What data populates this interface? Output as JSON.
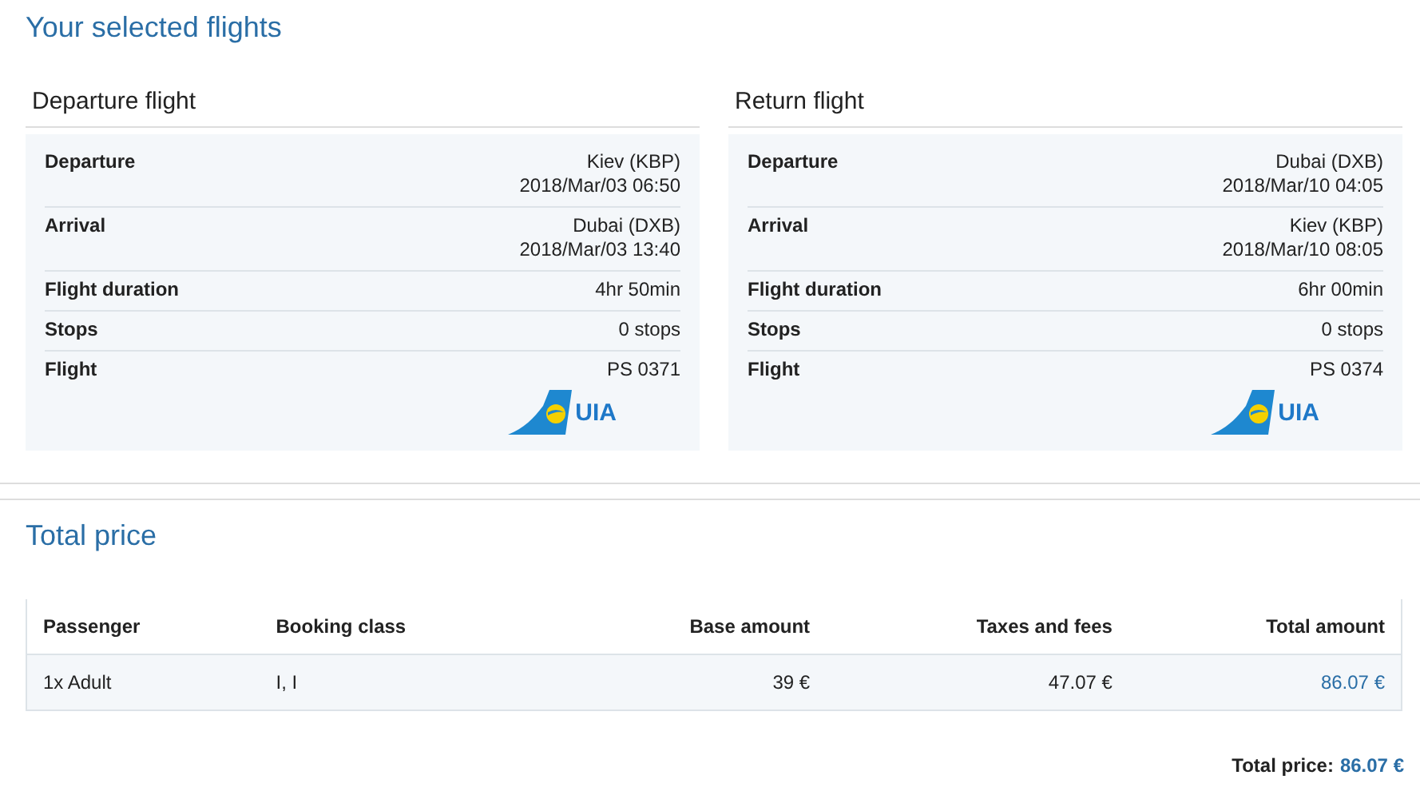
{
  "title": "Your selected flights",
  "flights": [
    {
      "heading": "Departure flight",
      "rows": [
        {
          "label": "Departure",
          "lines": [
            "Kiev (KBP)",
            "2018/Mar/03 06:50"
          ]
        },
        {
          "label": "Arrival",
          "lines": [
            "Dubai (DXB)",
            "2018/Mar/03 13:40"
          ]
        },
        {
          "label": "Flight duration",
          "lines": [
            "4hr 50min"
          ]
        },
        {
          "label": "Stops",
          "lines": [
            "0 stops"
          ]
        },
        {
          "label": "Flight",
          "lines": [
            "PS 0371"
          ]
        }
      ],
      "airline": "UIA"
    },
    {
      "heading": "Return flight",
      "rows": [
        {
          "label": "Departure",
          "lines": [
            "Dubai (DXB)",
            "2018/Mar/10 04:05"
          ]
        },
        {
          "label": "Arrival",
          "lines": [
            "Kiev (KBP)",
            "2018/Mar/10 08:05"
          ]
        },
        {
          "label": "Flight duration",
          "lines": [
            "6hr 00min"
          ]
        },
        {
          "label": "Stops",
          "lines": [
            "0 stops"
          ]
        },
        {
          "label": "Flight",
          "lines": [
            "PS 0374"
          ]
        }
      ],
      "airline": "UIA"
    }
  ],
  "price": {
    "title": "Total price",
    "table": {
      "columns": [
        "Passenger",
        "Booking class",
        "Base amount",
        "Taxes and fees",
        "Total amount"
      ],
      "rows": [
        [
          "1x Adult",
          "I, I",
          "39 €",
          "47.07 €",
          "86.07 €"
        ]
      ]
    },
    "total_label": "Total price:",
    "total_value": "86.07 €"
  }
}
